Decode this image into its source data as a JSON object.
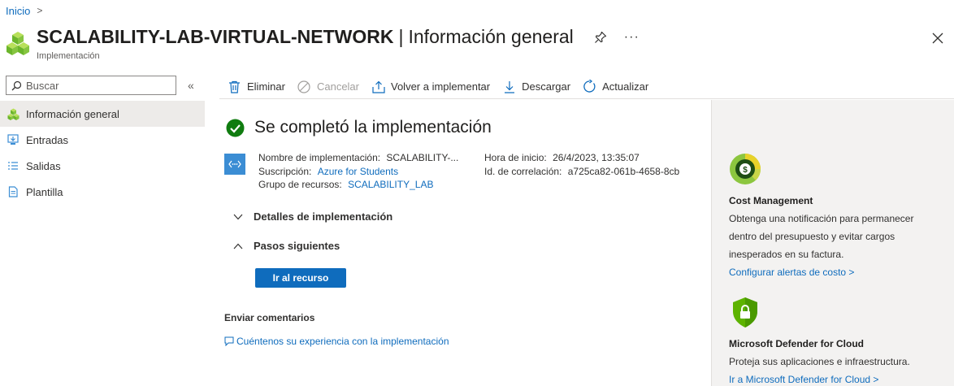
{
  "breadcrumb": {
    "home": "Inicio",
    "chevron": ">"
  },
  "header": {
    "resource_name": "SCALABILITY-LAB-VIRTUAL-NETWORK",
    "separator": "|",
    "page": "Información general",
    "subtitle": "Implementación",
    "more": "···"
  },
  "sidebar": {
    "search_placeholder": "Buscar",
    "collapse": "«",
    "items": [
      {
        "label": "Información general",
        "icon": "overview-icon",
        "active": true
      },
      {
        "label": "Entradas",
        "icon": "inputs-icon"
      },
      {
        "label": "Salidas",
        "icon": "outputs-icon"
      },
      {
        "label": "Plantilla",
        "icon": "template-icon"
      }
    ]
  },
  "toolbar": {
    "delete": "Eliminar",
    "cancel": "Cancelar",
    "redeploy": "Volver a implementar",
    "download": "Descargar",
    "refresh": "Actualizar"
  },
  "main": {
    "status": "Se completó la implementación",
    "deployment_name_label": "Nombre de implementación:",
    "deployment_name_value": "SCALABILITY-...",
    "subscription_label": "Suscripción:",
    "subscription_value": "Azure for Students",
    "resource_group_label": "Grupo de recursos:",
    "resource_group_value": "SCALABILITY_LAB",
    "start_time_label": "Hora de inicio:",
    "start_time_value": "26/4/2023, 13:35:07",
    "correlation_label": "Id. de correlación:",
    "correlation_value": "a725ca82-061b-4658-8cb",
    "details_section": "Detalles de implementación",
    "next_steps_section": "Pasos siguientes",
    "go_to_resource": "Ir al recurso",
    "feedback_title": "Enviar comentarios",
    "feedback_link": "Cuéntenos su experiencia con la implementación"
  },
  "right_panel": {
    "cost_title": "Cost Management",
    "cost_desc": "Obtenga una notificación para permanecer dentro del presupuesto y evitar cargos inesperados en su factura.",
    "cost_link": "Configurar alertas de costo >",
    "defender_title": "Microsoft Defender for Cloud",
    "defender_desc": "Proteja sus aplicaciones e infraestructura.",
    "defender_link": "Ir a Microsoft Defender for Cloud >"
  },
  "colors": {
    "accent": "#0f6cbd",
    "success": "#107c10",
    "deployment_icon": "#3b8dd4",
    "defender": "#5db300"
  }
}
